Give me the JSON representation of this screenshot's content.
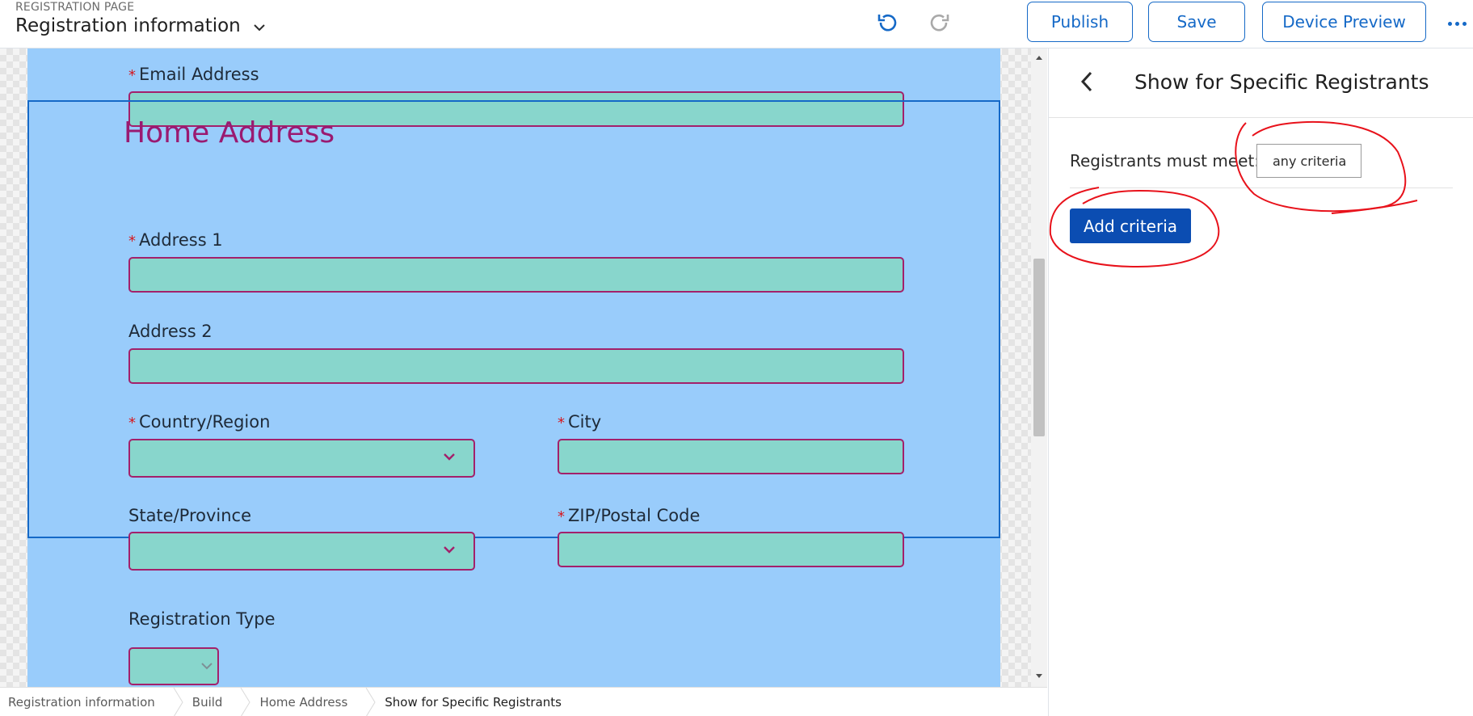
{
  "header": {
    "kicker": "REGISTRATION PAGE",
    "title": "Registration information",
    "buttons": {
      "publish": "Publish",
      "save": "Save",
      "preview": "Device Preview"
    }
  },
  "form": {
    "email_label": "Email Address",
    "section_title": "Home Address",
    "address1_label": "Address 1",
    "address2_label": "Address 2",
    "country_label": "Country/Region",
    "city_label": "City",
    "state_label": "State/Province",
    "zip_label": "ZIP/Postal Code",
    "regtype_label": "Registration Type",
    "required_marker": "*"
  },
  "breadcrumb": {
    "items": [
      "Registration information",
      "Build",
      "Home Address",
      "Show for Specific Registrants"
    ]
  },
  "panel": {
    "title": "Show for Specific Registrants",
    "meet_label": "Registrants must meet:",
    "criteria_value": "any criteria",
    "add_button": "Add criteria"
  },
  "colors": {
    "accent": "#1569c7",
    "form_background": "#99ccfb",
    "field_fill": "#88d6cc",
    "field_border": "#a3206b",
    "section_title": "#9a1a71",
    "primary_button": "#0b4db2",
    "annotation": "#e8121b"
  }
}
